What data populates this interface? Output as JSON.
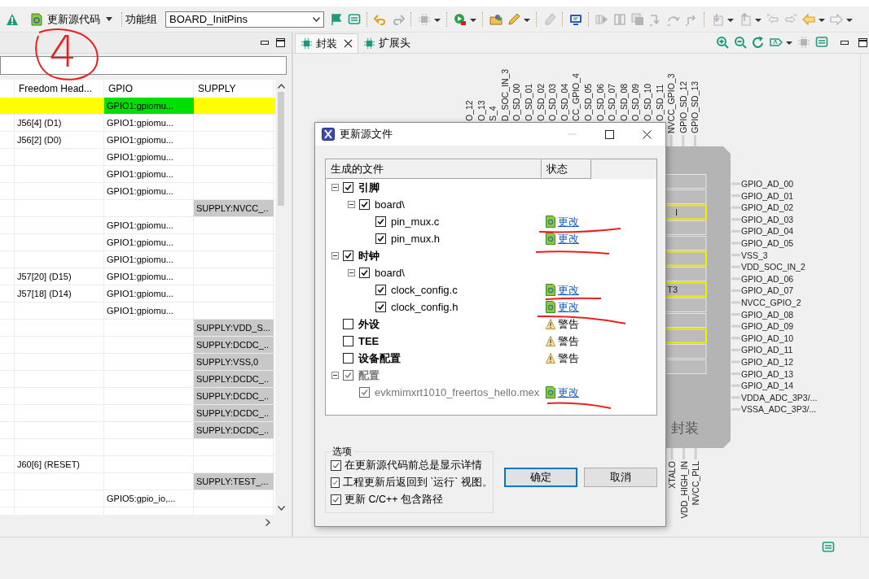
{
  "toolbar": {
    "update_button": {
      "label": "更新源代码"
    },
    "function_group": {
      "label": "功能组",
      "value": "BOARD_InitPins"
    },
    "icons": [
      {
        "kind": "flag",
        "disabled": false,
        "caret": false
      },
      {
        "kind": "notes",
        "disabled": false,
        "caret": false
      },
      {
        "kind": "separator"
      },
      {
        "kind": "undo",
        "disabled": false,
        "caret": false
      },
      {
        "kind": "redo",
        "disabled": true,
        "caret": false
      },
      {
        "kind": "separator"
      },
      {
        "kind": "chip",
        "disabled": true,
        "caret": true
      },
      {
        "kind": "separator"
      },
      {
        "kind": "run",
        "disabled": false,
        "caret": true
      },
      {
        "kind": "separator"
      },
      {
        "kind": "folder",
        "disabled": false,
        "caret": false
      },
      {
        "kind": "pen",
        "disabled": false,
        "caret": true
      },
      {
        "kind": "separator"
      },
      {
        "kind": "eraser",
        "disabled": true,
        "caret": false
      },
      {
        "kind": "separator"
      },
      {
        "kind": "monitor",
        "disabled": false,
        "caret": false
      },
      {
        "kind": "separator"
      },
      {
        "kind": "play-bars",
        "disabled": true,
        "caret": false
      },
      {
        "kind": "columns",
        "disabled": true,
        "caret": false
      },
      {
        "kind": "layers",
        "disabled": true,
        "caret": false
      },
      {
        "kind": "step-into",
        "disabled": true,
        "caret": false
      },
      {
        "kind": "step-over",
        "disabled": true,
        "caret": false
      },
      {
        "kind": "step-return",
        "disabled": true,
        "caret": false
      },
      {
        "kind": "separator"
      },
      {
        "kind": "import",
        "disabled": true,
        "caret": true
      },
      {
        "kind": "export",
        "disabled": true,
        "caret": true
      },
      {
        "kind": "back-star",
        "disabled": true,
        "caret": false
      },
      {
        "kind": "forward-star",
        "disabled": true,
        "caret": false
      },
      {
        "kind": "back",
        "disabled": false,
        "caret": true
      },
      {
        "kind": "forward",
        "disabled": true,
        "caret": true
      }
    ]
  },
  "annotation": {
    "text": "4"
  },
  "left_panel": {
    "table": {
      "columns": [
        "Freedom Head...",
        "GPIO",
        "SUPPLY"
      ],
      "rows": [
        {
          "freedom_header": "",
          "gpio": "GPIO1:gpiomu...",
          "supply": "",
          "selected": true
        },
        {
          "freedom_header": "J56[4] (D1)",
          "gpio": "GPIO1:gpiomu...",
          "supply": "",
          "selected": false
        },
        {
          "freedom_header": "J56[2] (D0)",
          "gpio": "GPIO1:gpiomu...",
          "supply": "",
          "selected": false
        },
        {
          "freedom_header": "",
          "gpio": "GPIO1:gpiomu...",
          "supply": "",
          "selected": false
        },
        {
          "freedom_header": "",
          "gpio": "GPIO1:gpiomu...",
          "supply": "",
          "selected": false
        },
        {
          "freedom_header": "",
          "gpio": "GPIO1:gpiomu...",
          "supply": "",
          "selected": false
        },
        {
          "freedom_header": "",
          "gpio": "",
          "supply": "SUPPLY:NVCC_..",
          "selected": false
        },
        {
          "freedom_header": "",
          "gpio": "GPIO1:gpiomu...",
          "supply": "",
          "selected": false
        },
        {
          "freedom_header": "",
          "gpio": "GPIO1:gpiomu...",
          "supply": "",
          "selected": false
        },
        {
          "freedom_header": "",
          "gpio": "GPIO1:gpiomu...",
          "supply": "",
          "selected": false
        },
        {
          "freedom_header": "J57[20] (D15)",
          "gpio": "GPIO1:gpiomu...",
          "supply": "",
          "selected": false
        },
        {
          "freedom_header": "J57[18] (D14)",
          "gpio": "GPIO1:gpiomu...",
          "supply": "",
          "selected": false
        },
        {
          "freedom_header": "",
          "gpio": "GPIO1:gpiomu...",
          "supply": "",
          "selected": false
        },
        {
          "freedom_header": "",
          "gpio": "",
          "supply": "SUPPLY:VDD_S...",
          "selected": false
        },
        {
          "freedom_header": "",
          "gpio": "",
          "supply": "SUPPLY:DCDC_..",
          "selected": false
        },
        {
          "freedom_header": "",
          "gpio": "",
          "supply": "SUPPLY:VSS,0",
          "selected": false
        },
        {
          "freedom_header": "",
          "gpio": "",
          "supply": "SUPPLY:DCDC_..",
          "selected": false
        },
        {
          "freedom_header": "",
          "gpio": "",
          "supply": "SUPPLY:DCDC_..",
          "selected": false
        },
        {
          "freedom_header": "",
          "gpio": "",
          "supply": "SUPPLY:DCDC_..",
          "selected": false
        },
        {
          "freedom_header": "",
          "gpio": "",
          "supply": "SUPPLY:DCDC_..",
          "selected": false
        },
        {
          "freedom_header": "",
          "gpio": "",
          "supply": "",
          "selected": false
        },
        {
          "freedom_header": "J60[6] (RESET)",
          "gpio": "",
          "supply": "",
          "selected": false
        },
        {
          "freedom_header": "",
          "gpio": "",
          "supply": "SUPPLY:TEST_...",
          "selected": false
        },
        {
          "freedom_header": "",
          "gpio": "GPIO5:gpio_io,...",
          "supply": "",
          "selected": false
        }
      ]
    }
  },
  "right_panel": {
    "tabs": [
      {
        "label": "封装",
        "selected": true,
        "closable": true
      },
      {
        "label": "扩展头",
        "selected": false,
        "closable": false
      }
    ],
    "icons": [
      {
        "kind": "zoom-in",
        "disabled": false,
        "caret": false
      },
      {
        "kind": "zoom-out",
        "disabled": false,
        "caret": false
      },
      {
        "kind": "rotate",
        "disabled": false,
        "caret": false
      },
      {
        "kind": "label",
        "disabled": false,
        "caret": true
      },
      {
        "kind": "chip",
        "disabled": true,
        "caret": false
      },
      {
        "kind": "notes",
        "disabled": false,
        "caret": false
      }
    ],
    "package_view": {
      "title": "封装",
      "top_pins": [
        "O_12",
        "O_13",
        "S_4",
        "D_SOC_IN_3",
        "O_SD_00",
        "O_SD_01",
        "O_SD_02",
        "O_SD_03",
        "O_SD_04",
        "CC_GPIO_4",
        "O_SD_05",
        "O_SD_06",
        "O_SD_07",
        "O_SD_08",
        "O_SD_09",
        "O_SD_10",
        "O_SD_11",
        "NVCC_GPIO_3",
        "GPIO_SD_12",
        "GPIO_SD_13"
      ],
      "right_pins": [
        "GPIO_AD_00",
        "GPIO_AD_01",
        "GPIO_AD_02",
        "GPIO_AD_03",
        "GPIO_AD_04",
        "GPIO_AD_05",
        "VSS_3",
        "VDD_SOC_IN_2",
        "GPIO_AD_06",
        "GPIO_AD_07",
        "NVCC_GPIO_2",
        "GPIO_AD_08",
        "GPIO_AD_09",
        "GPIO_AD_10",
        "GPIO_AD_11",
        "GPIO_AD_12",
        "GPIO_AD_13",
        "GPIO_AD_14",
        "VDDA_ADC_3P3/...",
        "VSSA_ADC_3P3/..."
      ],
      "bottom_pins": [
        "XTALO",
        "VDD_HIGH_IN",
        "NVCC_PLL"
      ],
      "pin_boxes": [
        {
          "highlighted": false
        },
        {
          "highlighted": false
        },
        {
          "highlighted": true,
          "label": "I"
        },
        {
          "highlighted": false
        },
        {
          "highlighted": false
        },
        {
          "highlighted": true
        },
        {
          "highlighted": false
        },
        {
          "highlighted": true,
          "label": "T3"
        },
        {
          "highlighted": false
        },
        {
          "highlighted": false
        },
        {
          "highlighted": true
        },
        {
          "highlighted": false
        },
        {
          "highlighted": false
        }
      ]
    }
  },
  "dialog": {
    "title": "更新源文件",
    "columns": [
      "生成的文件",
      "状态"
    ],
    "tree": [
      {
        "label": "引脚",
        "checked": true,
        "disabled": false,
        "expanded": true,
        "children": [
          {
            "label": "board\\",
            "checked": true,
            "disabled": false,
            "expanded": true,
            "children": [
              {
                "label": "pin_mux.c",
                "checked": true,
                "disabled": false,
                "status": {
                  "kind": "changed",
                  "text": "更改"
                }
              },
              {
                "label": "pin_mux.h",
                "checked": true,
                "disabled": false,
                "status": {
                  "kind": "changed",
                  "text": "更改"
                }
              }
            ]
          }
        ]
      },
      {
        "label": "时钟",
        "checked": true,
        "disabled": false,
        "expanded": true,
        "children": [
          {
            "label": "board\\",
            "checked": true,
            "disabled": false,
            "expanded": true,
            "children": [
              {
                "label": "clock_config.c",
                "checked": true,
                "disabled": false,
                "status": {
                  "kind": "changed",
                  "text": "更改"
                }
              },
              {
                "label": "clock_config.h",
                "checked": true,
                "disabled": false,
                "status": {
                  "kind": "changed",
                  "text": "更改"
                }
              }
            ]
          }
        ]
      },
      {
        "label": "外设",
        "checked": false,
        "disabled": false,
        "status": {
          "kind": "warning",
          "text": "警告"
        }
      },
      {
        "label": "TEE",
        "checked": false,
        "disabled": false,
        "status": {
          "kind": "warning",
          "text": "警告"
        }
      },
      {
        "label": "设备配置",
        "checked": false,
        "disabled": false,
        "status": {
          "kind": "warning",
          "text": "警告"
        }
      },
      {
        "label": "配置",
        "checked": true,
        "disabled": true,
        "expanded": true,
        "children": [
          {
            "label": "evkmimxrt1010_freertos_hello.mex",
            "checked": true,
            "disabled": true,
            "status": {
              "kind": "changed",
              "text": "更改"
            }
          }
        ]
      }
    ],
    "options": {
      "legend": "选项",
      "items": [
        {
          "label": "在更新源代码前总是显示详情",
          "checked": true
        },
        {
          "label": "工程更新后返回到 `运行` 视图。",
          "checked": true
        },
        {
          "label": "更新 C/C++ 包含路径",
          "checked": true
        }
      ]
    },
    "buttons": [
      {
        "label": "确定",
        "default": true
      },
      {
        "label": "取消",
        "default": false
      }
    ]
  }
}
